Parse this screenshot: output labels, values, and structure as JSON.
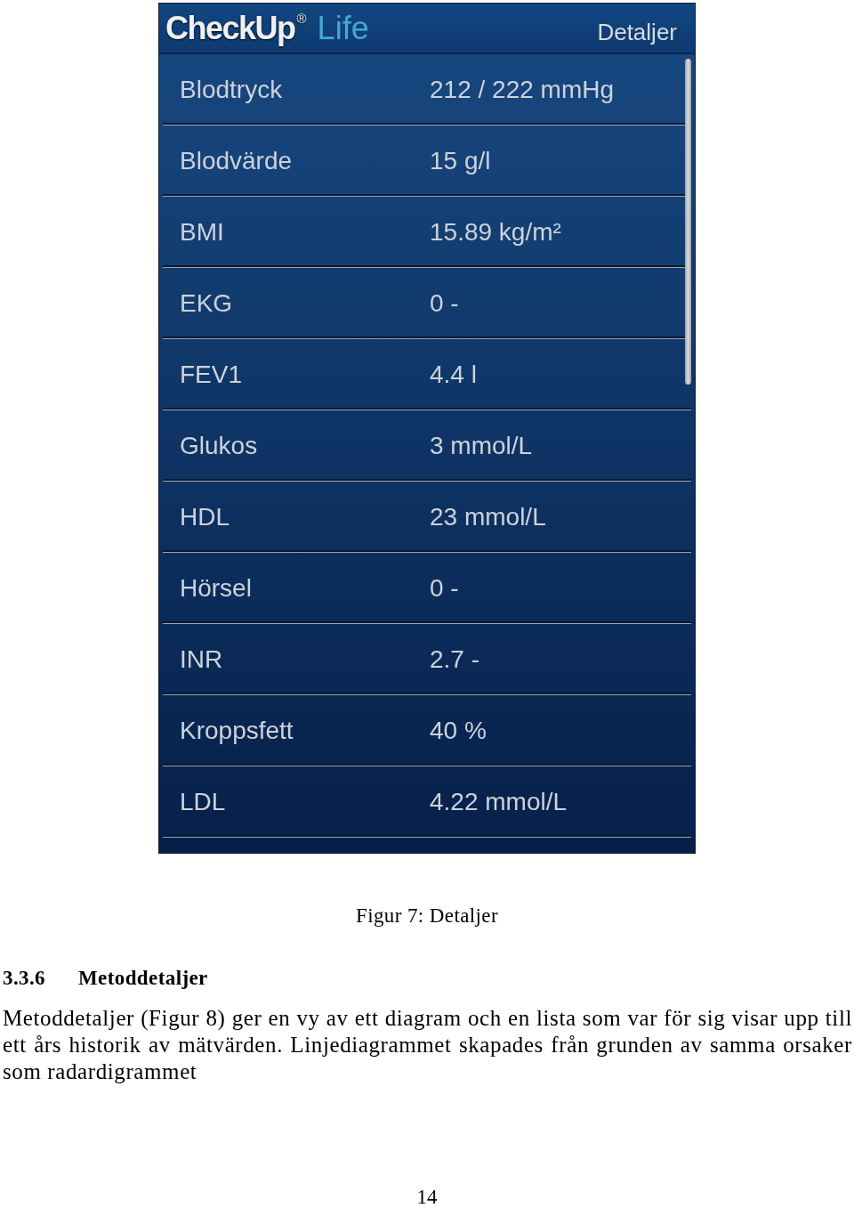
{
  "figure": {
    "app": {
      "logo": {
        "brand": "CheckUp$^{®}$",
        "product": "Life"
      },
      "title": "Detaljer",
      "rows": [
        {
          "label": "Blodtryck",
          "value": "212 / 222 mmHg"
        },
        {
          "label": "Blodvärde",
          "value": "15 g/l"
        },
        {
          "label": "BMI",
          "value": "15.89 kg/m²"
        },
        {
          "label": "EKG",
          "value": "0 -"
        },
        {
          "label": "FEV1",
          "value": "4.4 l"
        },
        {
          "label": "Glukos",
          "value": "3 mmol/L"
        },
        {
          "label": "HDL",
          "value": "23 mmol/L"
        },
        {
          "label": "Hörsel",
          "value": "0 -"
        },
        {
          "label": "INR",
          "value": "2.7 -"
        },
        {
          "label": "Kroppsfett",
          "value": "40 %"
        },
        {
          "label": "LDL",
          "value": "4.22 mmol/L"
        }
      ]
    },
    "caption": "Figur 7: Detaljer"
  },
  "section": {
    "number": "3.3.6",
    "title": "Metoddetaljer",
    "paragraph": "Metoddetaljer (Figur 8) ger en vy av ett diagram och en lista som var för sig visar upp till ett års historik av mätvärden. Linjediagrammet skapades från grunden av samma orsaker som radardigrammet"
  },
  "page_number": "14"
}
